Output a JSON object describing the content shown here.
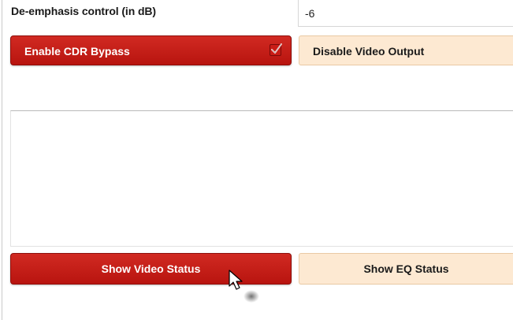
{
  "deemphasis": {
    "label": "De-emphasis control (in dB)",
    "value": "-6"
  },
  "buttons": {
    "enable_cdr_bypass": "Enable CDR Bypass",
    "enable_cdr_bypass_checked": true,
    "disable_video_output": "Disable Video Output",
    "show_video_status": "Show Video Status",
    "show_eq_status": "Show EQ Status"
  },
  "colors": {
    "accent_red": "#c91c16",
    "peach": "#fde9d2"
  },
  "icons": {
    "checkbox": "checkmark-icon",
    "cursor": "mouse-pointer-icon"
  }
}
